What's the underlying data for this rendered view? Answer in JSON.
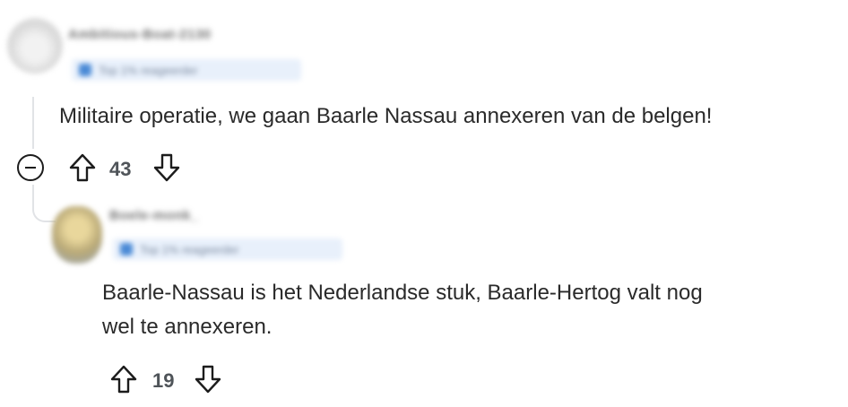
{
  "comments": [
    {
      "author": "Ambitious-Boat-2130",
      "flair": "Top 1% reageerder",
      "text": "Militaire operatie, we gaan Baarle Nassau annexeren van de belgen!",
      "score": "43"
    },
    {
      "author": "Boele-monk_",
      "flair": "Top 1% reageerder",
      "text_lines": [
        "Baarle-Nassau is het Nederlandse stuk, Baarle-Hertog valt nog",
        "wel te annexeren."
      ],
      "score": "19"
    }
  ],
  "colors": {
    "thread_line": "#e1e3e6",
    "text": "#2a2a2a",
    "score": "#4f5459",
    "flair_bg": "#e8f0fb"
  },
  "icons": {
    "upvote": "arrow-up-outline-icon",
    "downvote": "arrow-down-outline-icon",
    "collapse": "minus-circle-icon"
  }
}
